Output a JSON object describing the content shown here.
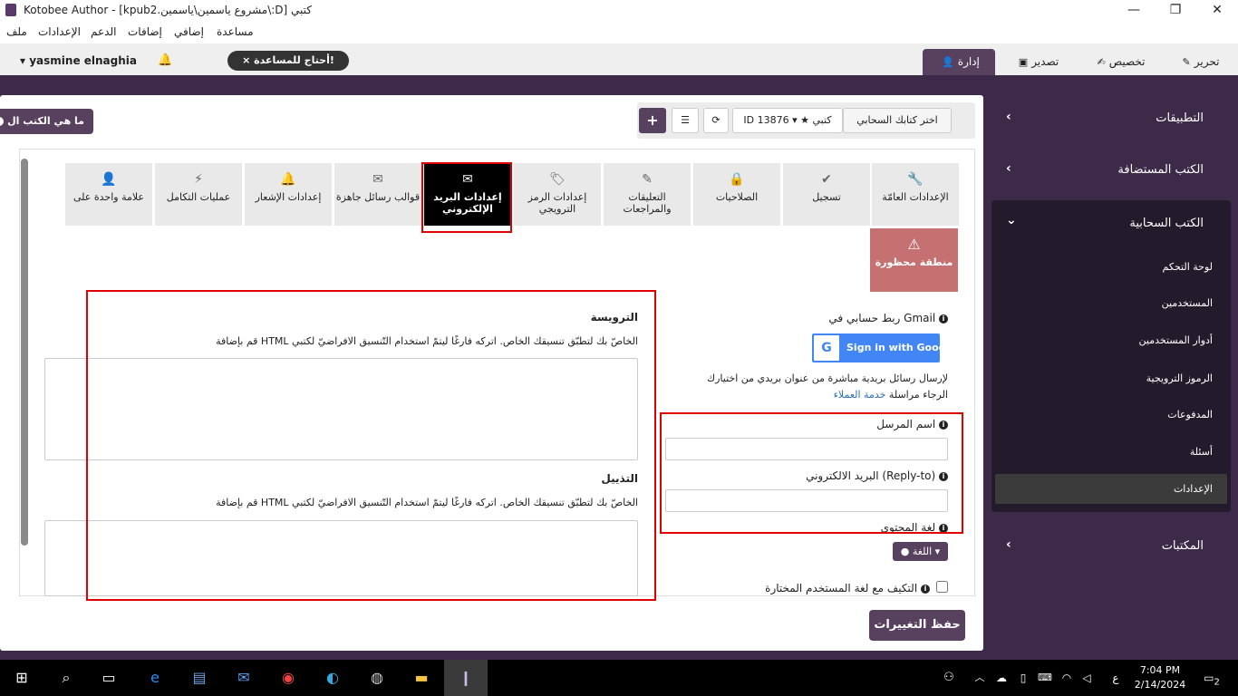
{
  "window": {
    "title": "Kotobee Author - [kpub2.مشروع ياسمين\\ياسمين\\:D] كتبي",
    "minimize": "—",
    "maximize": "❐",
    "close": "✕"
  },
  "menu": {
    "items": [
      "ملف",
      "الإعدادات",
      "الدعم",
      "إضافات",
      "إضافي",
      "مساعدة"
    ]
  },
  "topbar": {
    "tabs": [
      {
        "label": "تحرير",
        "icon": "✎"
      },
      {
        "label": "تخصيص",
        "icon": "✍"
      },
      {
        "label": "تصدير",
        "icon": "▣"
      },
      {
        "label": "إدارة",
        "icon": "👤"
      }
    ],
    "user": "yasmine elnaghia",
    "user_caret": "▾",
    "bell": "🔔",
    "help": "أحتاج للمساعدة!",
    "help_close": "×"
  },
  "sidebar": {
    "sections": [
      {
        "label": "التطبيقات",
        "chevron": "‹"
      },
      {
        "label": "الكتب المستضافة",
        "chevron": "‹"
      },
      {
        "label": "الكتب السحابية",
        "chevron": "⌄"
      },
      {
        "label": "المكتبات",
        "chevron": "‹"
      }
    ],
    "sub_items": [
      "لوحة التحكم",
      "المستخدمين",
      "أدوار المستخدمين",
      "الرموز الترويجية",
      "المدفوعات",
      "أسئلة",
      "الإعدادات"
    ]
  },
  "toolbar": {
    "choose_book": "اختر كتابك السحابي",
    "book": "★ كتبي",
    "book_id": "ID 13876 ▾",
    "refresh": "⟳",
    "list": "☰",
    "add": "+",
    "what_is": "ما هي الكتب ال",
    "what_is_icon": "i"
  },
  "settings_tabs": [
    {
      "label": "الإعدادات العامّة",
      "icon": "🔧"
    },
    {
      "label": "تسجيل",
      "icon": "✔"
    },
    {
      "label": "الصلاحيات",
      "icon": "🔒"
    },
    {
      "label": "التعليقات والمراجعات",
      "icon": "✎"
    },
    {
      "label": "إعدادات الرمز الترويجي",
      "icon": "🏷"
    },
    {
      "label": "إعدادات البريد الإلكتروني",
      "icon": "✉"
    },
    {
      "label": "قوالب رسائل جاهزة",
      "icon": "✉"
    },
    {
      "label": "إعدادات الإشعار",
      "icon": "🔔"
    },
    {
      "label": "عمليات التكامل",
      "icon": "⚡"
    },
    {
      "label": "علامة واحدة على",
      "icon": "👤"
    }
  ],
  "forbidden": {
    "icon": "⚠",
    "label": "منطقة محظورة"
  },
  "email": {
    "gmail_label": "ربط حسابي في Gmail",
    "google_btn": "Sign in with Google",
    "google_g": "G",
    "note_line1": "لإرسال رسائل بريدية مباشرة من عنوان بريدي من اختيارك",
    "note_line2_prefix": "الرجاء مراسلة",
    "note_link": "خدمة العملاء",
    "sender_label": "اسم المرسل",
    "sender_value": "",
    "reply_label": "البريد الالكتروني (Reply-to)",
    "reply_value": "",
    "content_lang_label": "لغة المحتوى",
    "lang_btn": "اللغة ▾",
    "adapt_label": "التكيف مع لغة المستخدم المختارة",
    "info_icon": "i"
  },
  "header_section": {
    "title": "الترويسة",
    "desc": "قم بإضافة HTML الخاصّ بك لتطبّق تنسيقك الخاص. اتركه فارغًا ليتمّ استخدام التّنسيق الافراضيّ لكتبي",
    "value": ""
  },
  "footer_section": {
    "title": "التذييل",
    "desc": "قم بإضافة HTML الخاصّ بك لتطبّق تنسيقك الخاص. اتركه فارغًا ليتمّ استخدام التّنسيق الافراضيّ لكتبي",
    "value": ""
  },
  "save": "حفظ التغييرات",
  "taskbar": {
    "time": "7:04 PM",
    "date": "2/14/2024",
    "lang": "ع",
    "notif": "2"
  }
}
